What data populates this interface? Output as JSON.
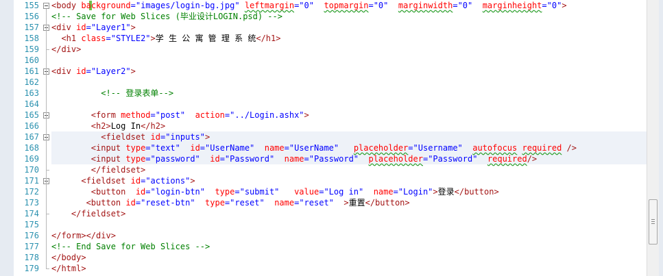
{
  "editor": {
    "line_numbers": [
      "155",
      "156",
      "157",
      "158",
      "159",
      "160",
      "161",
      "162",
      "163",
      "164",
      "165",
      "166",
      "167",
      "168",
      "169",
      "170",
      "171",
      "172",
      "173",
      "174",
      "175",
      "176",
      "177",
      "178",
      "179"
    ],
    "lines": [
      {
        "indent": "",
        "tokens": [
          {
            "t": "<",
            "c": "t"
          },
          {
            "t": "body",
            "c": "t"
          },
          {
            "t": " "
          },
          {
            "t": "background",
            "c": "a"
          },
          {
            "t": "=",
            "c": "v"
          },
          {
            "t": "\"images/login-bg.jpg\"",
            "c": "v"
          },
          {
            "t": " "
          },
          {
            "t": "leftmargin",
            "c": "a",
            "sq": true
          },
          {
            "t": "=",
            "c": "v"
          },
          {
            "t": "\"0\"",
            "c": "v"
          },
          {
            "t": "  "
          },
          {
            "t": "topmargin",
            "c": "a",
            "sq": true
          },
          {
            "t": "=",
            "c": "v"
          },
          {
            "t": "\"0\"",
            "c": "v"
          },
          {
            "t": "  "
          },
          {
            "t": "marginwidth",
            "c": "a",
            "sq": true
          },
          {
            "t": "=",
            "c": "v"
          },
          {
            "t": "\"0\"",
            "c": "v"
          },
          {
            "t": "  "
          },
          {
            "t": "marginheight",
            "c": "a",
            "sq": true
          },
          {
            "t": "=",
            "c": "v"
          },
          {
            "t": "\"0\"",
            "c": "v"
          },
          {
            "t": ">",
            "c": "t"
          }
        ]
      },
      {
        "indent": "",
        "tokens": [
          {
            "t": "<!-- Save for Web Slices (毕业设计LOGIN.psd) -->",
            "c": "c"
          }
        ]
      },
      {
        "indent": "",
        "tokens": [
          {
            "t": "<div",
            "c": "t"
          },
          {
            "t": " "
          },
          {
            "t": "id",
            "c": "a"
          },
          {
            "t": "=",
            "c": "v"
          },
          {
            "t": "\"Layer1\"",
            "c": "v"
          },
          {
            "t": ">",
            "c": "t"
          }
        ]
      },
      {
        "indent": "  ",
        "tokens": [
          {
            "t": "<h1",
            "c": "t"
          },
          {
            "t": " "
          },
          {
            "t": "class",
            "c": "a"
          },
          {
            "t": "=",
            "c": "v"
          },
          {
            "t": "\"STYLE2\"",
            "c": "v"
          },
          {
            "t": ">",
            "c": "t"
          },
          {
            "t": "学 生 公 寓 管 理 系 统"
          },
          {
            "t": "</h1>",
            "c": "t"
          }
        ]
      },
      {
        "indent": "",
        "tokens": [
          {
            "t": "</div>",
            "c": "t"
          }
        ]
      },
      {
        "indent": "",
        "tokens": []
      },
      {
        "indent": "",
        "tokens": [
          {
            "t": "<div",
            "c": "t"
          },
          {
            "t": " "
          },
          {
            "t": "id",
            "c": "a"
          },
          {
            "t": "=",
            "c": "v"
          },
          {
            "t": "\"Layer2\"",
            "c": "v"
          },
          {
            "t": ">",
            "c": "t"
          }
        ]
      },
      {
        "indent": "",
        "tokens": []
      },
      {
        "indent": "          ",
        "tokens": [
          {
            "t": "<!-- 登录表单-->",
            "c": "c"
          }
        ]
      },
      {
        "indent": "",
        "tokens": []
      },
      {
        "indent": "        ",
        "tokens": [
          {
            "t": "<form",
            "c": "t"
          },
          {
            "t": " "
          },
          {
            "t": "method",
            "c": "a"
          },
          {
            "t": "=",
            "c": "v"
          },
          {
            "t": "\"post\"",
            "c": "v"
          },
          {
            "t": "  "
          },
          {
            "t": "action",
            "c": "a"
          },
          {
            "t": "=",
            "c": "v"
          },
          {
            "t": "\"../Login.ashx\"",
            "c": "v"
          },
          {
            "t": ">",
            "c": "t"
          }
        ]
      },
      {
        "indent": "        ",
        "tokens": [
          {
            "t": "<h2>",
            "c": "t"
          },
          {
            "t": "Log In"
          },
          {
            "t": "</h2>",
            "c": "t"
          }
        ]
      },
      {
        "indent": "          ",
        "tokens": [
          {
            "t": "<fieldset",
            "c": "t"
          },
          {
            "t": " "
          },
          {
            "t": "id",
            "c": "a"
          },
          {
            "t": "=",
            "c": "v"
          },
          {
            "t": "\"inputs\"",
            "c": "v"
          },
          {
            "t": ">",
            "c": "t"
          }
        ]
      },
      {
        "indent": "        ",
        "tokens": [
          {
            "t": "<input",
            "c": "t"
          },
          {
            "t": " "
          },
          {
            "t": "type",
            "c": "a"
          },
          {
            "t": "=",
            "c": "v"
          },
          {
            "t": "\"text\"",
            "c": "v"
          },
          {
            "t": "  "
          },
          {
            "t": "id",
            "c": "a"
          },
          {
            "t": "=",
            "c": "v"
          },
          {
            "t": "\"UserName\"",
            "c": "v"
          },
          {
            "t": "  "
          },
          {
            "t": "name",
            "c": "a"
          },
          {
            "t": "=",
            "c": "v"
          },
          {
            "t": "\"UserName\"",
            "c": "v"
          },
          {
            "t": "   "
          },
          {
            "t": "placeholder",
            "c": "a",
            "sq": true
          },
          {
            "t": "=",
            "c": "v"
          },
          {
            "t": "\"Username\"",
            "c": "v"
          },
          {
            "t": "  "
          },
          {
            "t": "autofocus",
            "c": "a",
            "sq": true
          },
          {
            "t": " "
          },
          {
            "t": "required",
            "c": "a",
            "sq": true
          },
          {
            "t": " "
          },
          {
            "t": "/>",
            "c": "t"
          }
        ]
      },
      {
        "indent": "        ",
        "tokens": [
          {
            "t": "<input",
            "c": "t"
          },
          {
            "t": " "
          },
          {
            "t": "type",
            "c": "a"
          },
          {
            "t": "=",
            "c": "v"
          },
          {
            "t": "\"password\"",
            "c": "v"
          },
          {
            "t": "  "
          },
          {
            "t": "id",
            "c": "a"
          },
          {
            "t": "=",
            "c": "v"
          },
          {
            "t": "\"Password\"",
            "c": "v"
          },
          {
            "t": "  "
          },
          {
            "t": "name",
            "c": "a"
          },
          {
            "t": "=",
            "c": "v"
          },
          {
            "t": "\"Password\"",
            "c": "v"
          },
          {
            "t": "  "
          },
          {
            "t": "placeholder",
            "c": "a",
            "sq": true
          },
          {
            "t": "=",
            "c": "v"
          },
          {
            "t": "\"Password\"",
            "c": "v"
          },
          {
            "t": "  "
          },
          {
            "t": "required",
            "c": "a",
            "sq": true
          },
          {
            "t": "/>",
            "c": "t"
          }
        ]
      },
      {
        "indent": "        ",
        "tokens": [
          {
            "t": "</fieldset>",
            "c": "t"
          }
        ]
      },
      {
        "indent": "      ",
        "tokens": [
          {
            "t": "<fieldset",
            "c": "t"
          },
          {
            "t": " "
          },
          {
            "t": "id",
            "c": "a"
          },
          {
            "t": "=",
            "c": "v"
          },
          {
            "t": "\"actions\"",
            "c": "v"
          },
          {
            "t": ">",
            "c": "t"
          }
        ]
      },
      {
        "indent": "        ",
        "tokens": [
          {
            "t": "<button",
            "c": "t"
          },
          {
            "t": "  "
          },
          {
            "t": "id",
            "c": "a"
          },
          {
            "t": "=",
            "c": "v"
          },
          {
            "t": "\"login-btn\"",
            "c": "v"
          },
          {
            "t": "  "
          },
          {
            "t": "type",
            "c": "a"
          },
          {
            "t": "=",
            "c": "v"
          },
          {
            "t": "\"submit\"",
            "c": "v"
          },
          {
            "t": "   "
          },
          {
            "t": "value",
            "c": "a"
          },
          {
            "t": "=",
            "c": "v"
          },
          {
            "t": "\"Log in\"",
            "c": "v"
          },
          {
            "t": "  "
          },
          {
            "t": "name",
            "c": "a"
          },
          {
            "t": "=",
            "c": "v"
          },
          {
            "t": "\"Login\"",
            "c": "v"
          },
          {
            "t": ">",
            "c": "t"
          },
          {
            "t": "登录"
          },
          {
            "t": "</button>",
            "c": "t"
          }
        ]
      },
      {
        "indent": "       ",
        "tokens": [
          {
            "t": "<button",
            "c": "t"
          },
          {
            "t": " "
          },
          {
            "t": "id",
            "c": "a"
          },
          {
            "t": "=",
            "c": "v"
          },
          {
            "t": "\"reset-btn\"",
            "c": "v"
          },
          {
            "t": "  "
          },
          {
            "t": "type",
            "c": "a"
          },
          {
            "t": "=",
            "c": "v"
          },
          {
            "t": "\"reset\"",
            "c": "v"
          },
          {
            "t": "  "
          },
          {
            "t": "name",
            "c": "a"
          },
          {
            "t": "=",
            "c": "v"
          },
          {
            "t": "\"reset\"",
            "c": "v"
          },
          {
            "t": "  "
          },
          {
            "t": ">",
            "c": "t"
          },
          {
            "t": "重置"
          },
          {
            "t": "</button>",
            "c": "t"
          }
        ]
      },
      {
        "indent": "    ",
        "tokens": [
          {
            "t": "</fieldset>",
            "c": "t"
          }
        ]
      },
      {
        "indent": "",
        "tokens": []
      },
      {
        "indent": "",
        "tokens": [
          {
            "t": "</form></div>",
            "c": "t"
          }
        ]
      },
      {
        "indent": "",
        "tokens": [
          {
            "t": "<!-- End Save for Web Slices -->",
            "c": "c"
          }
        ]
      },
      {
        "indent": "",
        "tokens": [
          {
            "t": "</body>",
            "c": "t"
          }
        ]
      },
      {
        "indent": "",
        "tokens": [
          {
            "t": "</html>",
            "c": "t"
          }
        ]
      }
    ],
    "fold_lines": [
      "155",
      "157",
      "161",
      "165",
      "167",
      "171"
    ]
  },
  "colors": {
    "tag": "#a31515",
    "attribute": "#ff0000",
    "value": "#0000ff",
    "comment": "#008000",
    "line_number": "#2b91af",
    "squiggle": "#2ea02e"
  }
}
